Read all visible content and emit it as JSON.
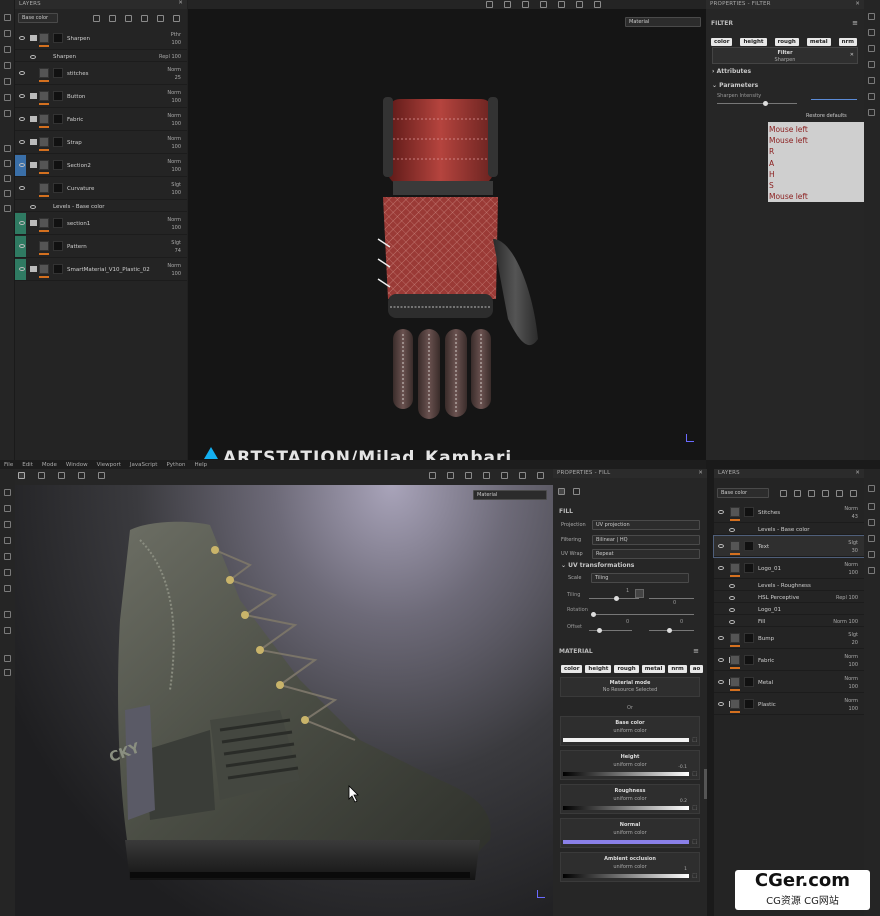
{
  "top": {
    "layers_panel": {
      "title": "LAYERS",
      "channel_select": "Base color",
      "layers": [
        {
          "name": "Sharpen",
          "blend": "Pthr",
          "opacity": "100",
          "group": true,
          "thumb2": "blk"
        },
        {
          "name": "Sharpen",
          "blend": "Repl",
          "opacity": "100",
          "sub": true
        },
        {
          "name": "stitches",
          "blend": "Norm",
          "opacity": "25"
        },
        {
          "name": "Button",
          "blend": "Norm",
          "opacity": "100",
          "group": true
        },
        {
          "name": "Fabric",
          "blend": "Norm",
          "opacity": "100",
          "group": true
        },
        {
          "name": "Strap",
          "blend": "Norm",
          "opacity": "100",
          "group": true
        },
        {
          "name": "Section2",
          "blend": "Norm",
          "opacity": "100",
          "group": true
        },
        {
          "name": "Curvature",
          "blend": "Slgt",
          "opacity": "100"
        },
        {
          "name": "Levels - Base color",
          "blend": "",
          "opacity": "",
          "sub": true
        },
        {
          "name": "section1",
          "blend": "Norm",
          "opacity": "100",
          "group": true
        },
        {
          "name": "Pattern",
          "blend": "Slgt",
          "opacity": "74"
        },
        {
          "name": "SmartMaterial_V10_Plastic_02",
          "blend": "Norm",
          "opacity": "100",
          "group": true
        }
      ]
    },
    "viewport": {
      "material_select": "Material",
      "watermark": "ARTSTATION/Milad_Kambari"
    },
    "properties": {
      "title": "PROPERTIES - FILTER",
      "section": "FILTER",
      "channels": [
        "color",
        "height",
        "rough",
        "metal",
        "nrm"
      ],
      "filter_label": "Filter",
      "filter_value": "Sharpen",
      "attributes": "Attributes",
      "parameters": "Parameters",
      "param_name": "Sharpen Intensity",
      "param_value": 0.25,
      "restore": "Restore defaults",
      "keylog": [
        "Mouse left",
        "Mouse left",
        "R",
        "A",
        "H",
        "S",
        "Mouse left"
      ]
    }
  },
  "menu": [
    "File",
    "Edit",
    "Mode",
    "Window",
    "Viewport",
    "JavaScript",
    "Python",
    "Help"
  ],
  "bottom": {
    "viewport": {
      "material_select": "Material",
      "boot_text": "ROCKY"
    },
    "properties": {
      "title": "PROPERTIES - FILL",
      "fill_section": "FILL",
      "projection_label": "Projection",
      "projection": "UV projection",
      "filtering_label": "Filtering",
      "filtering": "Bilinear | HQ",
      "uvwrap_label": "UV Wrap",
      "uvwrap": "Repeat",
      "uvtrans": "UV transformations",
      "scale_label": "Scale",
      "scale": "Tiling",
      "tiling_label": "Tiling",
      "tiling_value": "1",
      "rotation_label": "Rotation",
      "offset_label": "Offset",
      "offset_x": "0",
      "offset_y": "0",
      "zero": "0",
      "material_section": "MATERIAL",
      "channels": [
        "color",
        "height",
        "rough",
        "metal",
        "nrm",
        "ao"
      ],
      "material_mode": "Material mode",
      "no_resource": "No Resource Selected",
      "or": "Or",
      "channel_rows": [
        {
          "title": "Base color",
          "sub": "uniform color",
          "color": "#f2f2f2",
          "value": ""
        },
        {
          "title": "Height",
          "sub": "uniform color",
          "color": "gradient",
          "value": "-0.1"
        },
        {
          "title": "Roughness",
          "sub": "uniform color",
          "color": "gradient",
          "value": "0.2"
        },
        {
          "title": "Normal",
          "sub": "uniform color",
          "color": "#8a80e8",
          "value": ""
        },
        {
          "title": "Ambient occlusion",
          "sub": "uniform color",
          "color": "gradient",
          "value": "1"
        }
      ]
    },
    "layers_panel": {
      "title": "LAYERS",
      "channel_select": "Base color",
      "layers": [
        {
          "name": "Stitches",
          "blend": "Norm",
          "opacity": "43"
        },
        {
          "name": "Levels - Base color",
          "sub": true
        },
        {
          "name": "Text",
          "blend": "Slgt",
          "opacity": "30",
          "selected": true
        },
        {
          "name": "Logo_01",
          "blend": "Norm",
          "opacity": "100"
        },
        {
          "name": "Levels - Roughness",
          "sub": true
        },
        {
          "name": "HSL Perceptive",
          "blend": "Repl",
          "opacity": "100",
          "sub": true
        },
        {
          "name": "Logo_01",
          "sub": true
        },
        {
          "name": "Fill",
          "blend": "Norm",
          "opacity": "100",
          "sub": true
        },
        {
          "name": "Bump",
          "blend": "Slgt",
          "opacity": "20"
        },
        {
          "name": "Fabric",
          "blend": "Norm",
          "opacity": "100",
          "group": true
        },
        {
          "name": "Metal",
          "blend": "Norm",
          "opacity": "100",
          "group": true
        },
        {
          "name": "Plastic",
          "blend": "Norm",
          "opacity": "100",
          "group": true
        }
      ]
    }
  },
  "watermark": {
    "brand": "CGer.com",
    "sub": "CG资源 CG网站"
  }
}
